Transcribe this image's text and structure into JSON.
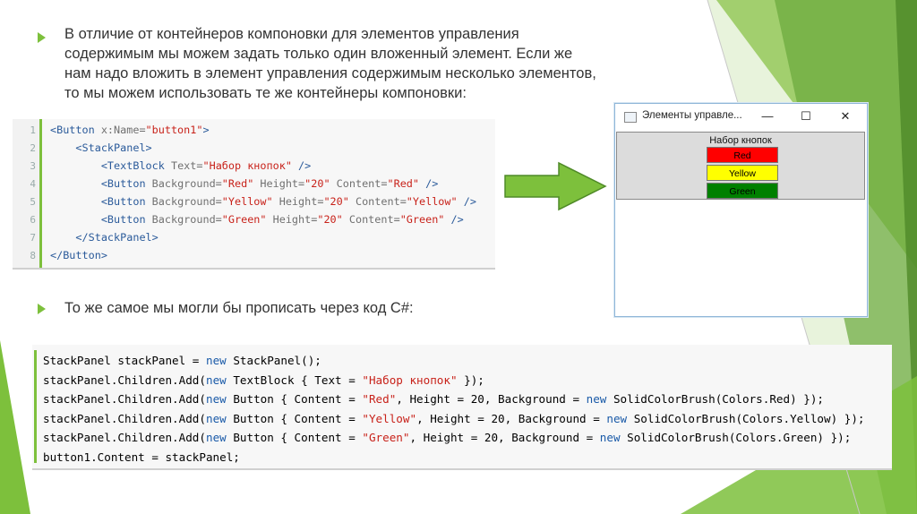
{
  "colors": {
    "accent": "#7dc03c",
    "dark_green": "#5a9a2a",
    "xml_tag": "#2a5a9a",
    "xml_value": "#c8221a",
    "keyword": "#1a5aa8",
    "class": "#2b91af"
  },
  "paragraph1": {
    "lines": [
      "В отличие от контейнеров компоновки для элементов управления",
      "содержимым мы можем задать только один вложенный элемент. Если же",
      "нам надо вложить в элемент управления содержимым несколько элементов,",
      "то мы можем использовать те же контейнеры компоновки:"
    ]
  },
  "paragraph2": {
    "text": "То же самое мы могли бы прописать через код C#:"
  },
  "xml_code": {
    "line_numbers": [
      "1",
      "2",
      "3",
      "4",
      "5",
      "6",
      "7",
      "8"
    ],
    "lines": [
      [
        [
          "tag",
          "<Button "
        ],
        [
          "attr",
          "x:Name="
        ],
        [
          "val",
          "\"button1\""
        ],
        [
          "tag",
          ">"
        ]
      ],
      [
        [
          "plain",
          "    "
        ],
        [
          "tag",
          "<StackPanel>"
        ]
      ],
      [
        [
          "plain",
          "        "
        ],
        [
          "tag",
          "<TextBlock "
        ],
        [
          "attr",
          "Text="
        ],
        [
          "val",
          "\"Набор кнопок\""
        ],
        [
          "tag",
          " />"
        ]
      ],
      [
        [
          "plain",
          "        "
        ],
        [
          "tag",
          "<Button "
        ],
        [
          "attr",
          "Background="
        ],
        [
          "val",
          "\"Red\""
        ],
        [
          "attr",
          " Height="
        ],
        [
          "val",
          "\"20\""
        ],
        [
          "attr",
          " Content="
        ],
        [
          "val",
          "\"Red\""
        ],
        [
          "tag",
          " />"
        ]
      ],
      [
        [
          "plain",
          "        "
        ],
        [
          "tag",
          "<Button "
        ],
        [
          "attr",
          "Background="
        ],
        [
          "val",
          "\"Yellow\""
        ],
        [
          "attr",
          " Height="
        ],
        [
          "val",
          "\"20\""
        ],
        [
          "attr",
          " Content="
        ],
        [
          "val",
          "\"Yellow\""
        ],
        [
          "tag",
          " />"
        ]
      ],
      [
        [
          "plain",
          "        "
        ],
        [
          "tag",
          "<Button "
        ],
        [
          "attr",
          "Background="
        ],
        [
          "val",
          "\"Green\""
        ],
        [
          "attr",
          " Height="
        ],
        [
          "val",
          "\"20\""
        ],
        [
          "attr",
          " Content="
        ],
        [
          "val",
          "\"Green\""
        ],
        [
          "tag",
          " />"
        ]
      ],
      [
        [
          "plain",
          "    "
        ],
        [
          "tag",
          "</StackPanel>"
        ]
      ],
      [
        [
          "tag",
          "</Button>"
        ]
      ]
    ]
  },
  "cs_code": {
    "lines": [
      [
        [
          "plain",
          "StackPanel stackPanel = "
        ],
        [
          "kw",
          "new"
        ],
        [
          "plain",
          " StackPanel();"
        ]
      ],
      [
        [
          "plain",
          "stackPanel.Children.Add("
        ],
        [
          "kw",
          "new"
        ],
        [
          "plain",
          " TextBlock { Text = "
        ],
        [
          "str",
          "\"Набор кнопок\""
        ],
        [
          "plain",
          " });"
        ]
      ],
      [
        [
          "plain",
          "stackPanel.Children.Add("
        ],
        [
          "kw",
          "new"
        ],
        [
          "plain",
          " Button { Content = "
        ],
        [
          "str",
          "\"Red\""
        ],
        [
          "plain",
          ", Height = 20, Background = "
        ],
        [
          "kw",
          "new"
        ],
        [
          "plain",
          " SolidColorBrush(Colors.Red) });"
        ]
      ],
      [
        [
          "plain",
          "stackPanel.Children.Add("
        ],
        [
          "kw",
          "new"
        ],
        [
          "plain",
          " Button { Content = "
        ],
        [
          "str",
          "\"Yellow\""
        ],
        [
          "plain",
          ", Height = 20, Background = "
        ],
        [
          "kw",
          "new"
        ],
        [
          "plain",
          " SolidColorBrush(Colors.Yellow) });"
        ]
      ],
      [
        [
          "plain",
          "stackPanel.Children.Add("
        ],
        [
          "kw",
          "new"
        ],
        [
          "plain",
          " Button { Content = "
        ],
        [
          "str",
          "\"Green\""
        ],
        [
          "plain",
          ", Height = 20, Background = "
        ],
        [
          "kw",
          "new"
        ],
        [
          "plain",
          " SolidColorBrush(Colors.Green) });"
        ]
      ],
      [
        [
          "plain",
          "button1.Content = stackPanel;"
        ]
      ]
    ]
  },
  "window": {
    "title": "Элементы управле...",
    "minimize_glyph": "—",
    "maximize_glyph": "☐",
    "close_glyph": "✕",
    "stack_label": "Набор кнопок",
    "buttons": [
      {
        "label": "Red",
        "color": "#ff0000"
      },
      {
        "label": "Yellow",
        "color": "#ffff00"
      },
      {
        "label": "Green",
        "color": "#008000"
      }
    ]
  }
}
